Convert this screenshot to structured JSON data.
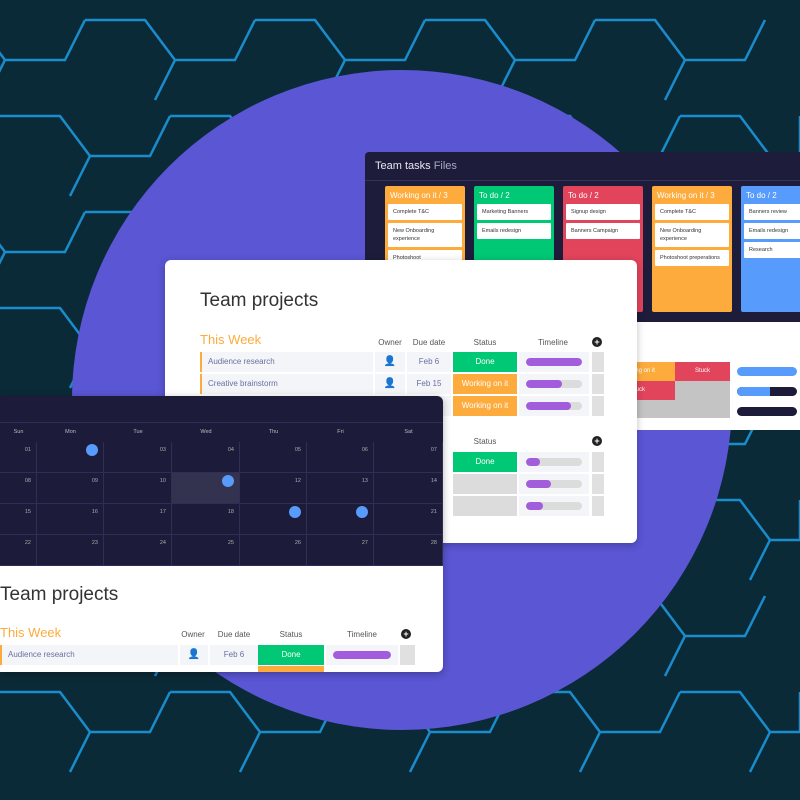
{
  "colors": {
    "background": "#0b2a38",
    "circle": "#5a56d4",
    "lines": "#1a8ccc",
    "done": "#00c875",
    "working": "#fdab3d",
    "stuck": "#e2445c",
    "todo_blue": "#579bfc",
    "timeline": "#a25ddc",
    "dark": "#1c1b3a"
  },
  "kanban": {
    "title": "Team tasks",
    "title_suffix": "Files",
    "columns": [
      {
        "title": "Working on it / 3",
        "color": "#fdab3d",
        "cards": [
          "Complete T&C",
          "New Onboarding experience",
          "Photoshoot"
        ]
      },
      {
        "title": "To do / 2",
        "color": "#00c875",
        "cards": [
          "Marketing Banners",
          "Emails redesign"
        ]
      },
      {
        "title": "To do / 2",
        "color": "#e2445c",
        "cards": [
          "Signup design",
          "Banners Campaign"
        ]
      },
      {
        "title": "Working on it / 3",
        "color": "#fdab3d",
        "cards": [
          "Complete T&C",
          "New Onboarding experience",
          "Photoshoot preperations"
        ]
      },
      {
        "title": "To do / 2",
        "color": "#579bfc",
        "cards": [
          "Banners review",
          "Emails redesign",
          "Research"
        ]
      }
    ],
    "lower": {
      "cells": [
        "Working on it",
        "Stuck",
        "Stuck"
      ],
      "timelines": [
        1.0,
        0.55,
        0.0
      ]
    }
  },
  "board": {
    "title": "Team projects",
    "group": "This Week",
    "headers": {
      "owner": "Owner",
      "due": "Due date",
      "status": "Status",
      "timeline": "Timeline"
    },
    "rows": [
      {
        "name": "Audience research",
        "owner": "person-icon",
        "date": "Feb 6",
        "status": "Done",
        "timeline": 1.0
      },
      {
        "name": "Creative brainstorm",
        "owner": "person-icon",
        "date": "Feb 15",
        "status": "Working on it",
        "timeline": 0.65
      },
      {
        "name": "",
        "owner": "",
        "date": "",
        "status": "Working on it",
        "timeline": 0.8
      }
    ],
    "group2_rows": [
      {
        "status": "Done",
        "timeline": 0.25
      },
      {
        "status": "",
        "timeline": 0.45
      },
      {
        "status": "",
        "timeline": 0.3
      }
    ]
  },
  "calendar": {
    "days": [
      "Sun",
      "Mon",
      "Tue",
      "Wed",
      "Thu",
      "Fri",
      "Sat"
    ],
    "weeks": [
      [
        "01",
        "",
        "03",
        "04",
        "05",
        "06",
        "07"
      ],
      [
        "08",
        "09",
        "10",
        "",
        "12",
        "13",
        "14"
      ],
      [
        "15",
        "16",
        "17",
        "18",
        "",
        "",
        "21"
      ],
      [
        "22",
        "23",
        "24",
        "25",
        "26",
        "27",
        "28"
      ]
    ],
    "events": [
      [
        0,
        1
      ],
      [
        1,
        3
      ],
      [
        2,
        4
      ],
      [
        2,
        5
      ]
    ],
    "highlight": [
      1,
      3
    ]
  },
  "board2": {
    "title": "Team projects",
    "group": "This Week",
    "headers": {
      "owner": "Owner",
      "due": "Due date",
      "status": "Status",
      "timeline": "Timeline"
    },
    "row": {
      "name": "Audience research",
      "date": "Feb 6",
      "status": "Done",
      "timeline": 1.0
    }
  }
}
